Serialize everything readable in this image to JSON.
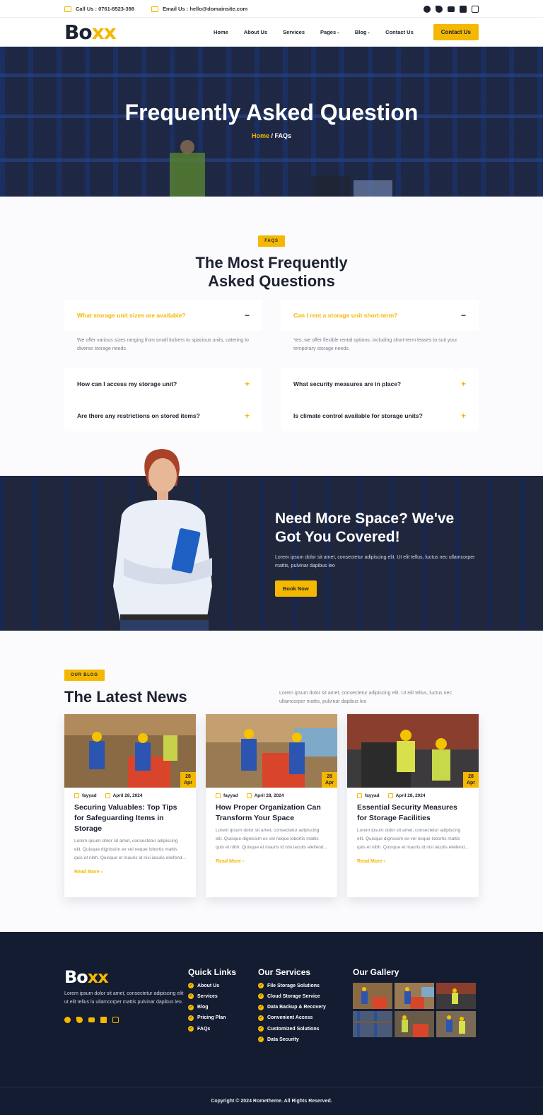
{
  "topbar": {
    "call": "Call Us : 0761-8523-398",
    "email": "Email Us : hello@domainsite.com",
    "social": [
      "facebook-icon",
      "twitter-icon",
      "youtube-icon",
      "linkedin-icon",
      "instagram-icon"
    ]
  },
  "nav": {
    "logo_main": "Bo",
    "logo_accent": "xx",
    "items": [
      "Home",
      "About Us",
      "Services",
      "Pages",
      "Blog",
      "Contact Us"
    ],
    "cta": "Contact Us"
  },
  "hero": {
    "title": "Frequently Asked Question",
    "crumb_home": "Home",
    "crumb_sep": " / ",
    "crumb_current": "FAQs"
  },
  "faq": {
    "badge": "FAQS",
    "title_line1": "The Most Frequently",
    "title_line2": "Asked Questions",
    "left": {
      "open_q": "What storage unit sizes are available?",
      "open_a": "We offer various sizes ranging from small lockers to spacious units, catering to diverse storage needs.",
      "closed": [
        "How can I access my storage unit?",
        "Are there any restrictions on stored items?"
      ]
    },
    "right": {
      "open_q": "Can I rent a storage unit short-term?",
      "open_a": "Yes, we offer flexible rental options, including short-term leases to suit your temporary storage needs.",
      "closed": [
        "What security measures are in place?",
        "Is climate control available for storage units?"
      ]
    },
    "minus": "−",
    "plus": "+"
  },
  "promo": {
    "title_line1": "Need More Space? We've",
    "title_line2": "Got You Covered!",
    "text": "Lorem ipsum dolor sit amet, consectetur adipiscing elit. Ut elit tellus, luctus nec ullamcorper mattis, pulvinar dapibus leo",
    "cta": "Book Now"
  },
  "blog": {
    "badge": "OUR BLOG",
    "title": "The Latest News",
    "intro": "Lorem ipsum dolor sit amet, consectetur adipiscing elit. Ut elit tellus, luctus nec ullamcorper mattis, pulvinar dapibus leo",
    "posts": [
      {
        "day": "28",
        "month": "Apr",
        "author": "fayyad",
        "date": "April 28, 2024",
        "title": "Securing Valuables: Top Tips for Safeguarding Items in Storage",
        "excerpt": "Lorem ipsum dolor sit amet, consectetur adipiscing elit. Quisque dignissim ex vel neque lobortis mattis quis et nibh. Quisque et mauris id nisi iaculis eleifend...",
        "more": "Read More"
      },
      {
        "day": "28",
        "month": "Apr",
        "author": "fayyad",
        "date": "April 28, 2024",
        "title": "How Proper Organization Can Transform Your Space",
        "excerpt": "Lorem ipsum dolor sit amet, consectetur adipiscing elit. Quisque dignissim ex vel neque lobortis mattis quis et nibh. Quisque et mauris id nisi iaculis eleifend...",
        "more": "Read More"
      },
      {
        "day": "28",
        "month": "Apr",
        "author": "fayyad",
        "date": "April 28, 2024",
        "title": "Essential Security Measures for Storage Facilities",
        "excerpt": "Lorem ipsum dolor sit amet, consectetur adipiscing elit. Quisque dignissim ex vel neque lobortis mattis quis et nibh. Quisque et mauris id nisi iaculis eleifend...",
        "more": "Read More"
      }
    ]
  },
  "footer": {
    "logo_main": "Bo",
    "logo_accent": "xx",
    "about": "Lorem ipsum dolor sit amet, consectetur adipiscing elit ut elit tellus lu ullamcorper mattis pulvinar dapibus leo.",
    "quick_title": "Quick Links",
    "quick": [
      "About Us",
      "Services",
      "Blog",
      "Pricing Plan",
      "FAQs"
    ],
    "services_title": "Our Services",
    "services": [
      "File Storage Solutions",
      "Cloud Storage Service",
      "Data Backup & Recovery",
      "Convenient Access",
      "Customized Solutions",
      "Data Security"
    ],
    "gallery_title": "Our Gallery",
    "copyright": "Copyright © 2024 Rometheme. All Rights Reserved."
  },
  "colors": {
    "accent": "#f5b800",
    "navy": "#141c31",
    "text": "#1c2230"
  }
}
